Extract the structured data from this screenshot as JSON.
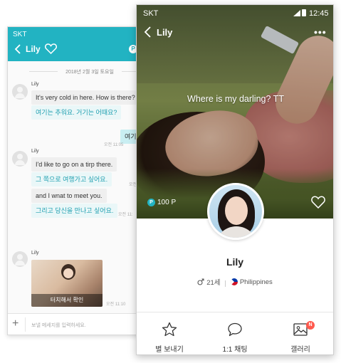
{
  "chat_screen": {
    "carrier": "SKT",
    "title": "Lily",
    "points_badge": "P",
    "date_divider": "2018년 2월 3일 토요일",
    "messages": [
      {
        "sender": "Lily",
        "text": "It's very cold in here. How is there?",
        "translation": "여기는 추워요. 거기는 어때요?"
      },
      {
        "mine_text": "여기",
        "time": "오전 11:05"
      },
      {
        "sender": "Lily",
        "text": "I'd like to go on a tirp there.",
        "translation": "그 쪽으로 여행가고 싶어요.",
        "time": "오전 11:"
      },
      {
        "text": "and I wnat to meet you.",
        "translation": "그리고 당신을 만나고 싶어요.",
        "time": "오전 11:"
      },
      {
        "sender": "Lily",
        "photo_caption": "터치해서 확인",
        "time": "오전 11:10"
      }
    ],
    "input_placeholder": "보낼 메세지를 입력하세요."
  },
  "profile_screen": {
    "carrier": "SKT",
    "clock": "12:45",
    "title": "Lily",
    "more_label": "•••",
    "status_message": "Where is my darling? TT",
    "points": "100 P",
    "points_icon": "P",
    "name": "Lily",
    "age": "21세",
    "country": "Philippines",
    "actions": [
      {
        "label": "별 보내기",
        "icon": "star-icon"
      },
      {
        "label": "1:1 채팅",
        "icon": "chat-bubble-icon"
      },
      {
        "label": "갤러리",
        "icon": "gallery-icon",
        "badge": "N"
      }
    ]
  },
  "colors": {
    "accent": "#22b3c2",
    "translation_text": "#1e9fb0",
    "badge": "#ff5a4e"
  }
}
